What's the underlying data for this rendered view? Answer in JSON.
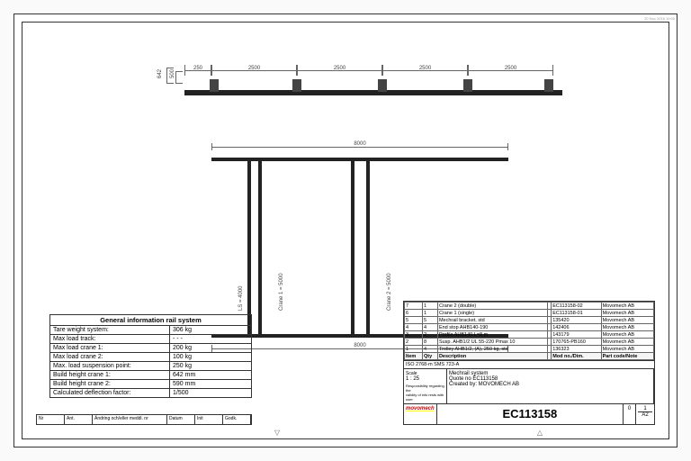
{
  "timestamp": "20 Nov 2018 10:00",
  "top_dims": [
    "250",
    "2500",
    "2500",
    "2500",
    "2500"
  ],
  "side_dims": [
    "642",
    "500"
  ],
  "plan_dim": "8000",
  "plan_labels": {
    "ls": "LS = 4000",
    "c1": "Crane 1 = 5000",
    "c2": "Crane 2 = 5000"
  },
  "info": {
    "title": "General information rail system",
    "rows": [
      {
        "k": "Tare weight system:",
        "v": "306 kg"
      },
      {
        "k": "Max load track:",
        "v": "- - -"
      },
      {
        "k": "Max load crane 1:",
        "v": "200 kg"
      },
      {
        "k": "Max load crane 2:",
        "v": "100 kg"
      },
      {
        "k": "Max. load suspension point:",
        "v": "250 kg"
      },
      {
        "k": "Build height crane 1:",
        "v": "642 mm"
      },
      {
        "k": "Build height crane 2:",
        "v": "590 mm"
      },
      {
        "k": "Calculated deflection factor:",
        "v": "1/500"
      }
    ]
  },
  "bom": {
    "headers": [
      "Item",
      "Qty",
      "Description",
      "",
      "Mod no./Dim.",
      "Part code/Note"
    ],
    "rows": [
      [
        "7",
        "1",
        "Crane 2 (double)",
        "",
        "EC113158-02",
        "Movomech AB"
      ],
      [
        "6",
        "1",
        "Crane 1 (single)",
        "",
        "EC113158-01",
        "Movomech AB"
      ],
      [
        "5",
        "5",
        "Mechrail bracket, std",
        "",
        "135420",
        "Movomech AB"
      ],
      [
        "4",
        "4",
        "End stop AHB140-190",
        "",
        "142406",
        "Movomech AB"
      ],
      [
        "3",
        "2",
        "Profile AHB140 L=8 m",
        "",
        "143179",
        "Movomech AB"
      ],
      [
        "2",
        "8",
        "Susp. AHB1/2 UL 55-220 Pmax 10",
        "",
        "170765-PB160",
        "Movomech AB"
      ],
      [
        "1",
        "4",
        "Trolley AHB1/2, (A), 250 kg, std",
        "",
        "136323",
        "Movomech AB"
      ]
    ]
  },
  "standard": "ISO 2768-m SMS 723-A",
  "title_block": {
    "l1": "Mechrail system",
    "l2": "Quote no EC113158",
    "l3": "Created by: MOVOMECH AB",
    "scale": "1 : 25",
    "dwg": "EC113158",
    "sheet": "1",
    "of": "A2",
    "rev": "0"
  },
  "sig_headers": [
    "Nr",
    "Ant.",
    "Ändring och/eller meddl. nr",
    "Datum",
    "Init",
    "Godk."
  ],
  "logo": "movomech"
}
